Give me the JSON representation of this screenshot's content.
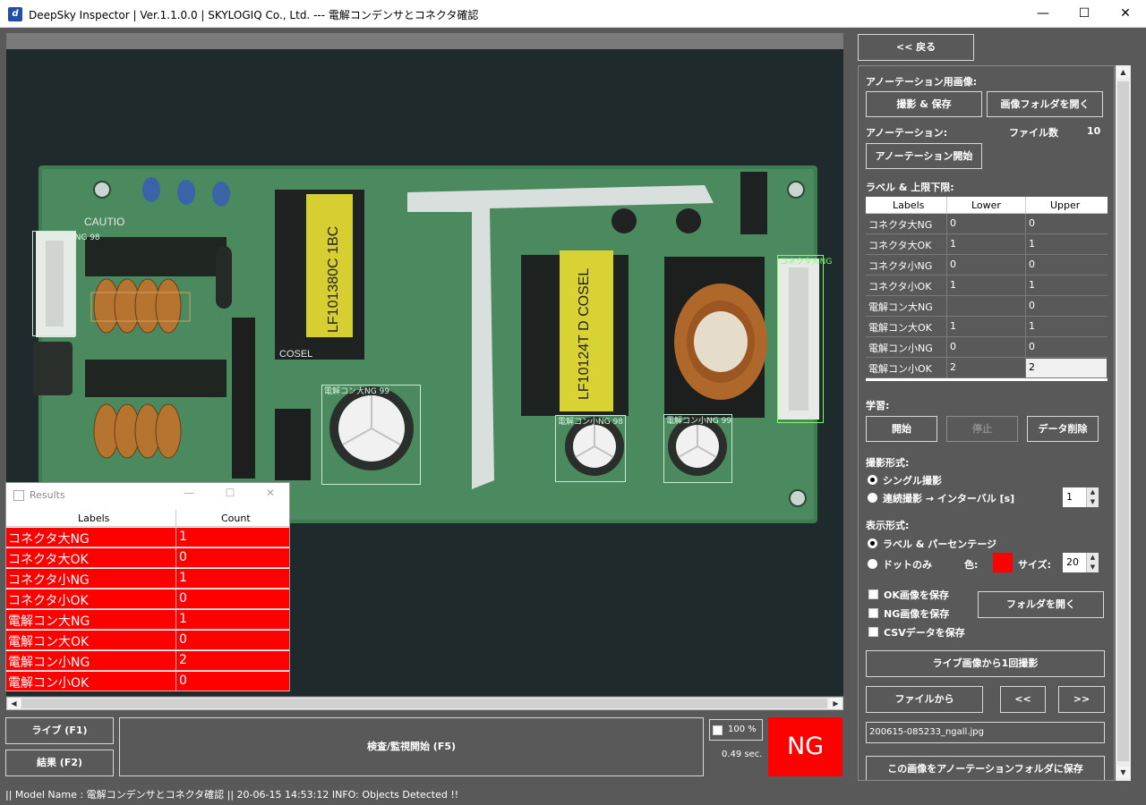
{
  "window": {
    "title": "DeepSky Inspector | Ver.1.1.0.0 | SKYLOGIQ Co., Ltd. --- 電解コンデンサとコネクタ確認",
    "minimize": "—",
    "maximize": "☐",
    "close": "✕"
  },
  "detections": [
    {
      "label": "コネクタ小NG 98"
    },
    {
      "label": "コネクタ大NG"
    },
    {
      "label": "電解コン大NG 99"
    },
    {
      "label": "電解コン小NG 98"
    },
    {
      "label": "電解コン小NG 99"
    }
  ],
  "pcb_text": {
    "transformer1": "LF101380C 1BC",
    "transformer2": "LF10124T D COSEL",
    "brand": "COSEL",
    "caution": "CAUTIO"
  },
  "results": {
    "title": "Results",
    "minimize": "—",
    "maximize": "☐",
    "close": "✕",
    "header_labels": "Labels",
    "header_count": "Count",
    "rows": [
      {
        "label": "コネクタ大NG",
        "count": "1"
      },
      {
        "label": "コネクタ大OK",
        "count": "0"
      },
      {
        "label": "コネクタ小NG",
        "count": "1"
      },
      {
        "label": "コネクタ小OK",
        "count": "0"
      },
      {
        "label": "電解コン大NG",
        "count": "1"
      },
      {
        "label": "電解コン大OK",
        "count": "0"
      },
      {
        "label": "電解コン小NG",
        "count": "2"
      },
      {
        "label": "電解コン小OK",
        "count": "0"
      }
    ]
  },
  "bottom": {
    "live_button": "ライブ (F1)",
    "result_button": "結果 (F2)",
    "inspect_button": "検査/監視開始 (F5)",
    "zoom": "100 %",
    "elapsed": "0.49 sec.",
    "verdict": "NG"
  },
  "status": {
    "text": "|| Model Name : 電解コンデンサとコネクタ確認 ||    20-06-15 14:53:12   INFO:   Objects Detected !!"
  },
  "panel": {
    "back_button": "<< 戻る",
    "annotation_image_section": "アノーテーション用画像:",
    "capture_save_button": "撮影 & 保存",
    "open_image_folder_button": "画像フォルダを開く",
    "annotation_section": "アノーテーション:",
    "file_count_label": "ファイル数",
    "file_count_value": "10",
    "start_annotation_button": "アノーテーション開始",
    "label_limits_section": "ラベル & 上限下限:",
    "table_headers": {
      "labels": "Labels",
      "lower": "Lower",
      "upper": "Upper"
    },
    "table_rows": [
      {
        "label": "コネクタ大NG",
        "lower": "0",
        "upper": "0"
      },
      {
        "label": "コネクタ大OK",
        "lower": "1",
        "upper": "1"
      },
      {
        "label": "コネクタ小NG",
        "lower": "0",
        "upper": "0"
      },
      {
        "label": "コネクタ小OK",
        "lower": "1",
        "upper": "1"
      },
      {
        "label": "電解コン大NG",
        "lower": "",
        "upper": "0"
      },
      {
        "label": "電解コン大OK",
        "lower": "1",
        "upper": "1"
      },
      {
        "label": "電解コン小NG",
        "lower": "0",
        "upper": "0"
      },
      {
        "label": "電解コン小OK",
        "lower": "2",
        "upper": "2"
      }
    ],
    "learning_section": "学習:",
    "start_button": "開始",
    "stop_button": "停止",
    "delete_data_button": "データ削除",
    "capture_mode_section": "撮影形式:",
    "single_capture": "シングル撮影",
    "continuous_capture": "連続撮影 → インターバル [s]",
    "interval_value": "1",
    "display_mode_section": "表示形式:",
    "label_percentage": "ラベル & パーセンテージ",
    "dot_only": "ドットのみ",
    "color_label": "色:",
    "size_label": "サイズ:",
    "size_value": "20",
    "save_ok": "OK画像を保存",
    "save_ng": "NG画像を保存",
    "save_csv": "CSVデータを保存",
    "open_folder_button": "フォルダを開く",
    "capture_from_live_button": "ライブ画像から1回撮影",
    "from_file_button": "ファイルから",
    "prev_button": "<<",
    "next_button": ">>",
    "filename": "200615-085233_ngall.jpg",
    "save_to_annotation_button": "この画像をアノーテーションフォルダに保存"
  },
  "colors": {
    "background": "#595959",
    "ng_red": "#ff0000",
    "detection_box": "#c7ecd6",
    "detection_box_green": "#7dff6a",
    "pcb_green": "#3d7a52"
  }
}
